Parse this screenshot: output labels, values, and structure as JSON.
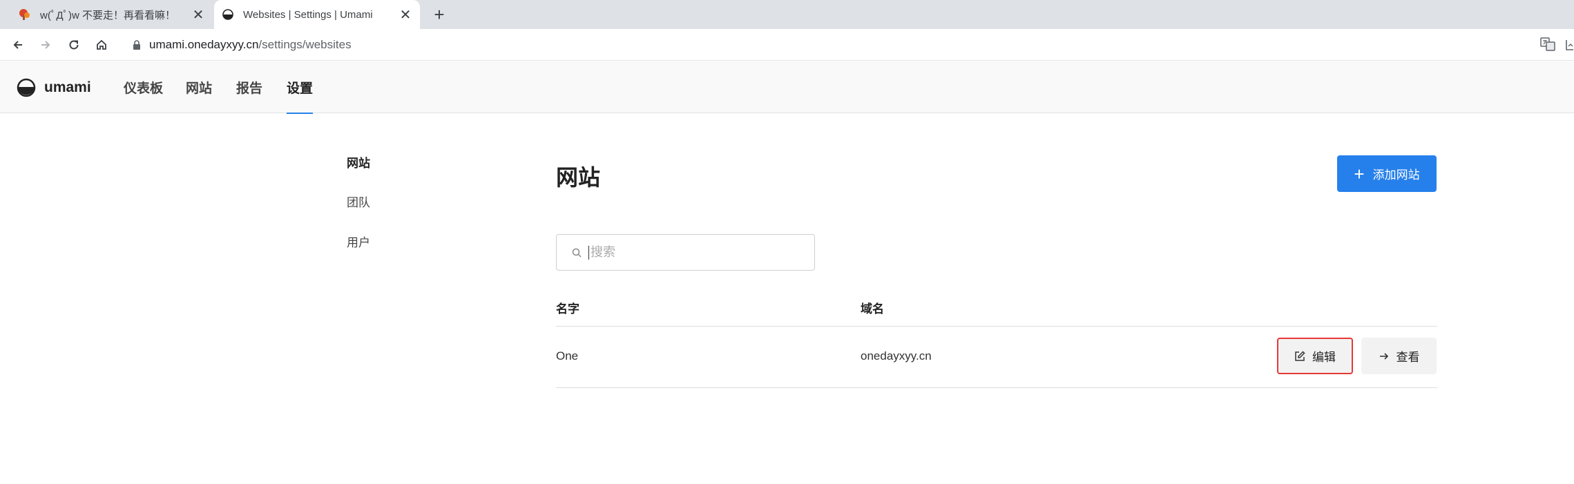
{
  "browser": {
    "tabs": [
      {
        "title": "w(ﾟДﾟ)w 不要走！再看看嘛！"
      },
      {
        "title": "Websites | Settings | Umami"
      }
    ],
    "url_host": "umami.onedayxyy.cn",
    "url_path": "/settings/websites"
  },
  "app": {
    "brand": "umami",
    "nav": [
      {
        "label": "仪表板"
      },
      {
        "label": "网站"
      },
      {
        "label": "报告"
      },
      {
        "label": "设置"
      }
    ]
  },
  "sidebar": {
    "items": [
      {
        "label": "网站"
      },
      {
        "label": "团队"
      },
      {
        "label": "用户"
      }
    ]
  },
  "main": {
    "title": "网站",
    "add_button_label": "添加网站",
    "search_placeholder": "搜索",
    "columns": [
      "名字",
      "域名"
    ],
    "rows": [
      {
        "name": "One",
        "domain": "onedayxyy.cn",
        "edit_label": "编辑",
        "view_label": "查看"
      }
    ]
  },
  "colors": {
    "accent": "#2680eb",
    "highlight_border": "#e53935"
  }
}
